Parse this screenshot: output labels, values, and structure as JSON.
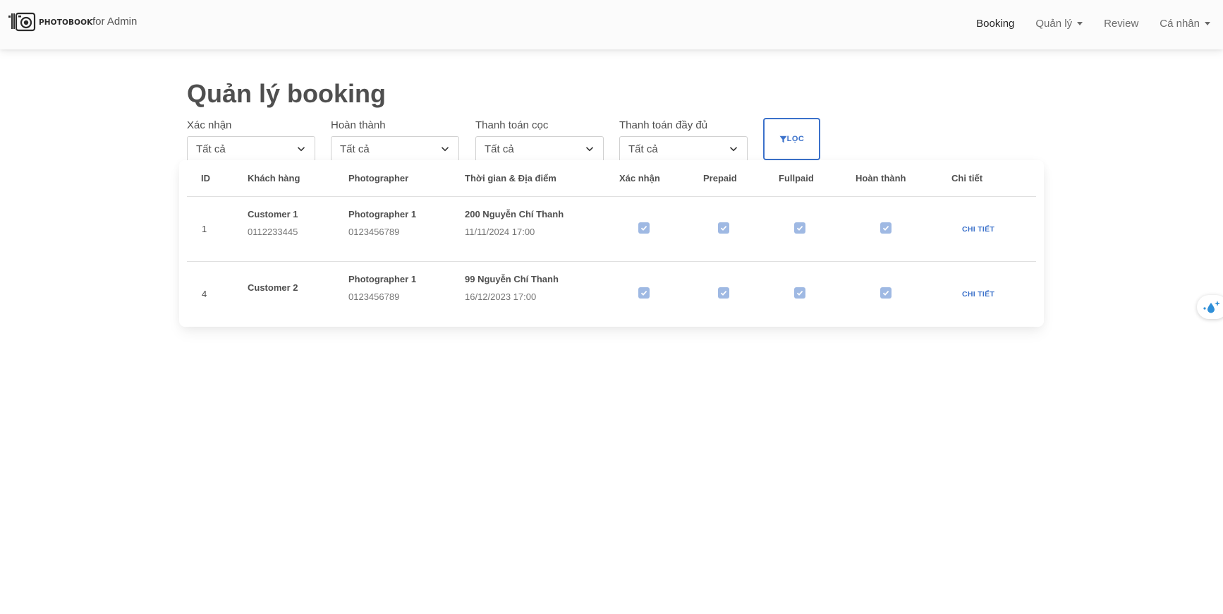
{
  "brand": {
    "wordmark": "PHOTOBOOK",
    "subtitle": "for Admin"
  },
  "nav": {
    "items": [
      {
        "label": "Booking",
        "active": true,
        "dropdown": false
      },
      {
        "label": "Quản lý",
        "active": false,
        "dropdown": true
      },
      {
        "label": "Review",
        "active": false,
        "dropdown": false
      },
      {
        "label": "Cá nhân",
        "active": false,
        "dropdown": true
      }
    ]
  },
  "page": {
    "title": "Quản lý booking"
  },
  "filters": [
    {
      "label": "Xác nhận",
      "value": "Tất cả"
    },
    {
      "label": "Hoàn thành",
      "value": "Tất cả"
    },
    {
      "label": "Thanh toán cọc",
      "value": "Tất cả"
    },
    {
      "label": "Thanh toán đầy đủ",
      "value": "Tất cả"
    }
  ],
  "filter_button": {
    "label": "LỌC",
    "icon": "filter-icon"
  },
  "table": {
    "columns": [
      "ID",
      "Khách hàng",
      "Photographer",
      "Thời gian & Địa điểm",
      "Xác nhận",
      "Prepaid",
      "Fullpaid",
      "Hoàn thành",
      "Chi tiết"
    ],
    "rows": [
      {
        "id": "1",
        "customer_name": "Customer 1",
        "customer_phone": "0112233445",
        "photographer_name": "Photographer 1",
        "photographer_phone": "0123456789",
        "location": "200 Nguyễn Chí Thanh",
        "time": "11/11/2024 17:00",
        "confirmed": true,
        "prepaid": true,
        "fullpaid": true,
        "completed": true,
        "detail_label": "CHI TIẾT"
      },
      {
        "id": "4",
        "customer_name": "Customer 2",
        "customer_phone": "",
        "photographer_name": "Photographer 1",
        "photographer_phone": "0123456789",
        "location": "99 Nguyễn Chí Thanh",
        "time": "16/12/2023 17:00",
        "confirmed": true,
        "prepaid": true,
        "fullpaid": true,
        "completed": true,
        "detail_label": "CHI TIẾT"
      }
    ]
  },
  "colors": {
    "accent": "#3b71ca",
    "checkbox_disabled": "#9fb9e3",
    "navbar_bg": "#fbfbfb",
    "text": "#4f4f4f"
  }
}
